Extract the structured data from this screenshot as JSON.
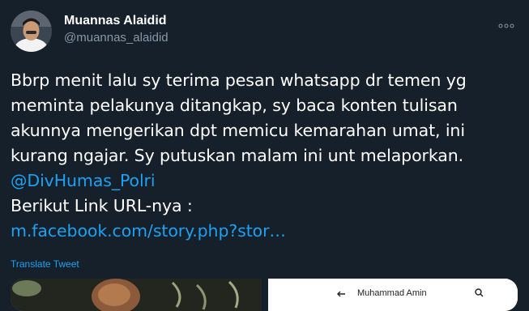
{
  "tweet": {
    "author_name": "Muannas Alaidid",
    "author_handle": "@muannas_alaidid",
    "lines": [
      "Bbrp menit lalu sy terima pesan whatsapp dr temen yg",
      "meminta pelakunya ditangkap, sy baca konten tulisan",
      "akunnya mengerikan dpt memicu kemarahan umat, ini",
      "kurang ngajar. Sy putuskan malam ini unt melaporkan."
    ],
    "mention": "@DivHumas_Polri",
    "link_intro": "Berikut Link URL-nya :",
    "link_url": "m.facebook.com/story.php?stor…",
    "translate_label": "Translate Tweet",
    "more_icon": "more-horizontal-icon"
  },
  "media": {
    "fb_header_name": "Muhammad Amin",
    "back_icon": "arrow-left-icon",
    "search_icon": "search-icon"
  },
  "colors": {
    "background": "#15202b",
    "text": "#ffffff",
    "muted": "#8899a6",
    "link": "#1da1f2"
  }
}
